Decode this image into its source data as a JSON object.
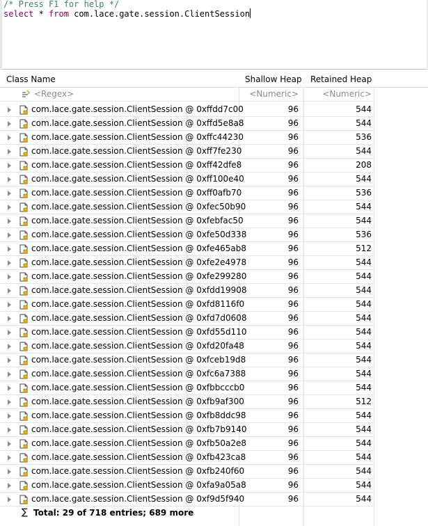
{
  "editor": {
    "comment": "/* Press F1 for help */",
    "kw_select": "select",
    "query_mid": " * ",
    "kw_from": "from",
    "query_tail": " com.lace.gate.session.ClientSession"
  },
  "table": {
    "columns": [
      "Class Name",
      "Shallow Heap",
      "Retained Heap"
    ],
    "filter": {
      "name": "<Regex>",
      "shallow": "<Numeric>",
      "retained": "<Numeric>"
    },
    "rows": [
      {
        "name": "com.lace.gate.session.ClientSession @ 0xffdd7c00",
        "shallow": "96",
        "retained": "544"
      },
      {
        "name": "com.lace.gate.session.ClientSession @ 0xffd5e8a8",
        "shallow": "96",
        "retained": "544"
      },
      {
        "name": "com.lace.gate.session.ClientSession @ 0xffc44230",
        "shallow": "96",
        "retained": "536"
      },
      {
        "name": "com.lace.gate.session.ClientSession @ 0xff7fe230",
        "shallow": "96",
        "retained": "544"
      },
      {
        "name": "com.lace.gate.session.ClientSession @ 0xff42dfe8",
        "shallow": "96",
        "retained": "208"
      },
      {
        "name": "com.lace.gate.session.ClientSession @ 0xff100e40",
        "shallow": "96",
        "retained": "544"
      },
      {
        "name": "com.lace.gate.session.ClientSession @ 0xff0afb70",
        "shallow": "96",
        "retained": "536"
      },
      {
        "name": "com.lace.gate.session.ClientSession @ 0xfec50b90",
        "shallow": "96",
        "retained": "544"
      },
      {
        "name": "com.lace.gate.session.ClientSession @ 0xfebfac50",
        "shallow": "96",
        "retained": "544"
      },
      {
        "name": "com.lace.gate.session.ClientSession @ 0xfe50d338",
        "shallow": "96",
        "retained": "536"
      },
      {
        "name": "com.lace.gate.session.ClientSession @ 0xfe465ab8",
        "shallow": "96",
        "retained": "512"
      },
      {
        "name": "com.lace.gate.session.ClientSession @ 0xfe2e4978",
        "shallow": "96",
        "retained": "544"
      },
      {
        "name": "com.lace.gate.session.ClientSession @ 0xfe299280",
        "shallow": "96",
        "retained": "544"
      },
      {
        "name": "com.lace.gate.session.ClientSession @ 0xfdd19908",
        "shallow": "96",
        "retained": "544"
      },
      {
        "name": "com.lace.gate.session.ClientSession @ 0xfd8116f0",
        "shallow": "96",
        "retained": "544"
      },
      {
        "name": "com.lace.gate.session.ClientSession @ 0xfd7d0608",
        "shallow": "96",
        "retained": "544"
      },
      {
        "name": "com.lace.gate.session.ClientSession @ 0xfd55d110",
        "shallow": "96",
        "retained": "544"
      },
      {
        "name": "com.lace.gate.session.ClientSession @ 0xfd20fa48",
        "shallow": "96",
        "retained": "544"
      },
      {
        "name": "com.lace.gate.session.ClientSession @ 0xfceb19d8",
        "shallow": "96",
        "retained": "544"
      },
      {
        "name": "com.lace.gate.session.ClientSession @ 0xfc6a7388",
        "shallow": "96",
        "retained": "544"
      },
      {
        "name": "com.lace.gate.session.ClientSession @ 0xfbbcccb0",
        "shallow": "96",
        "retained": "544"
      },
      {
        "name": "com.lace.gate.session.ClientSession @ 0xfb9af300",
        "shallow": "96",
        "retained": "512"
      },
      {
        "name": "com.lace.gate.session.ClientSession @ 0xfb8ddc98",
        "shallow": "96",
        "retained": "544"
      },
      {
        "name": "com.lace.gate.session.ClientSession @ 0xfb7b9140",
        "shallow": "96",
        "retained": "544"
      },
      {
        "name": "com.lace.gate.session.ClientSession @ 0xfb50a2e8",
        "shallow": "96",
        "retained": "544"
      },
      {
        "name": "com.lace.gate.session.ClientSession @ 0xfb423ca8",
        "shallow": "96",
        "retained": "544"
      },
      {
        "name": "com.lace.gate.session.ClientSession @ 0xfb240f60",
        "shallow": "96",
        "retained": "544"
      },
      {
        "name": "com.lace.gate.session.ClientSession @ 0xfa9a05a8",
        "shallow": "96",
        "retained": "544"
      },
      {
        "name": "com.lace.gate.session.ClientSession @ 0xf9d5f940",
        "shallow": "96",
        "retained": "544"
      }
    ],
    "total": "Total: 29 of 718 entries; 689 more"
  },
  "icons": {
    "expander": "triangle-right-icon",
    "object": "object-instance-icon",
    "regex": "regex-filter-icon",
    "total": "sigma-icon"
  },
  "colors": {
    "comment": "#3f7f5f",
    "keyword": "#7f0055",
    "filter_text": "#8a8a8a"
  }
}
